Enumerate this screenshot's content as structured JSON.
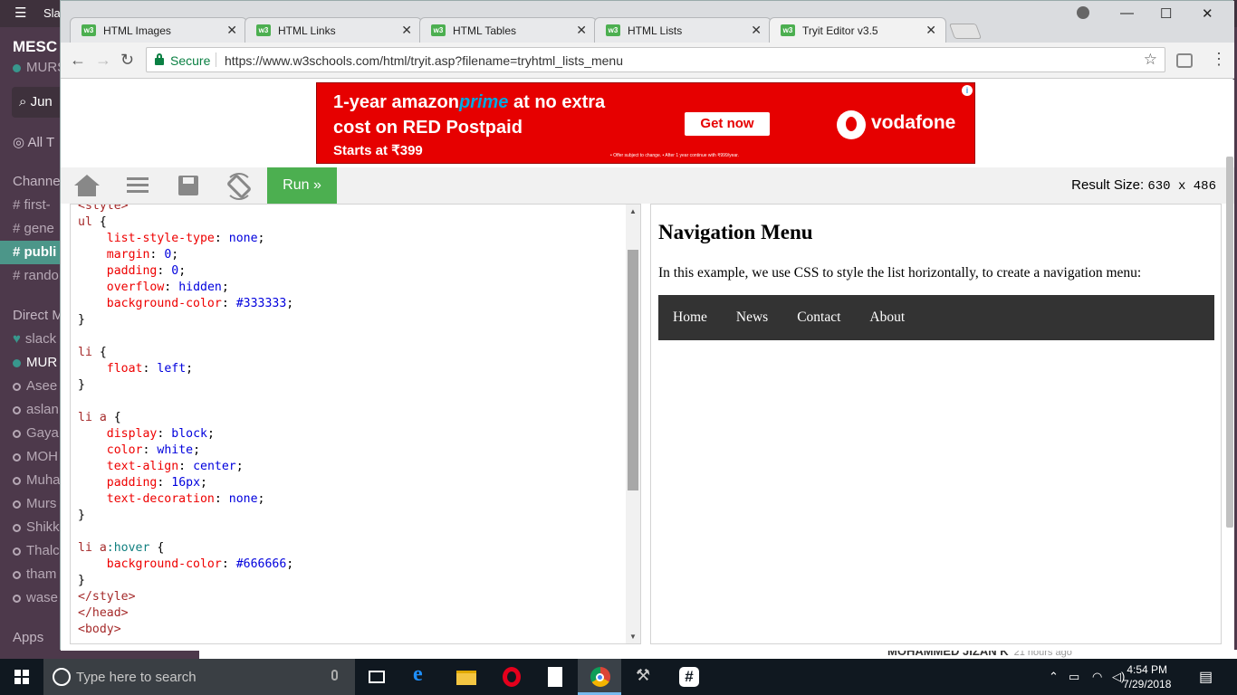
{
  "slack": {
    "window_title": "Sla",
    "team_name": "MESC",
    "user_status": "MURS",
    "jump_label": "Jun",
    "all_threads": "All T",
    "channels_header": "Channe",
    "channels": [
      "first-",
      "gene",
      "publi",
      "rando"
    ],
    "active_channel_index": 2,
    "dm_header": "Direct M",
    "dms": [
      {
        "name": "slack",
        "status": "heart"
      },
      {
        "name": "MUR",
        "status": "online"
      },
      {
        "name": "Asee",
        "status": "away"
      },
      {
        "name": "aslan",
        "status": "away"
      },
      {
        "name": "Gaya",
        "status": "away"
      },
      {
        "name": "MOH",
        "status": "away"
      },
      {
        "name": "Muha",
        "status": "away"
      },
      {
        "name": "Murs",
        "status": "away"
      },
      {
        "name": "Shikk",
        "status": "away"
      },
      {
        "name": "Thalc",
        "status": "away"
      },
      {
        "name": "tham",
        "status": "away"
      },
      {
        "name": "wase",
        "status": "away"
      }
    ],
    "apps_label": "Apps",
    "message_author": "MOHAMMED JIZAN K",
    "message_time": "21 hours ago"
  },
  "chrome": {
    "tabs": [
      {
        "label": "HTML Images",
        "active": false
      },
      {
        "label": "HTML Links",
        "active": false
      },
      {
        "label": "HTML Tables",
        "active": false
      },
      {
        "label": "HTML Lists",
        "active": false
      },
      {
        "label": "Tryit Editor v3.5",
        "active": true
      }
    ],
    "secure_label": "Secure",
    "url": "https://www.w3schools.com/html/tryit.asp?filename=tryhtml_lists_menu"
  },
  "ad": {
    "line1_pre": "1-year ",
    "line1_amazon": "amazon",
    "line1_prime": "prime",
    "line1_post": " at no extra",
    "line2": "cost on RED Postpaid",
    "line3": "Starts at ₹399",
    "cta": "Get now",
    "brand": "vodafone",
    "fine_print": "• Offer subject to change. • After 1 year continue with ₹999/year."
  },
  "tryit": {
    "run_label": "Run »",
    "result_size_label": "Result Size:",
    "result_size_value": "630 x 486"
  },
  "result": {
    "heading": "Navigation Menu",
    "paragraph": "In this example, we use CSS to style the list horizontally, to create a navigation menu:",
    "nav_items": [
      "Home",
      "News",
      "Contact",
      "About"
    ]
  },
  "taskbar": {
    "search_placeholder": "Type here to search",
    "time": "4:54 PM",
    "date": "7/29/2018"
  },
  "colors": {
    "slack_sidebar": "#4d394b",
    "slack_active": "#4c9689",
    "w3_green": "#4caf50",
    "nav_bg": "#333333",
    "ad_red": "#e60000"
  }
}
